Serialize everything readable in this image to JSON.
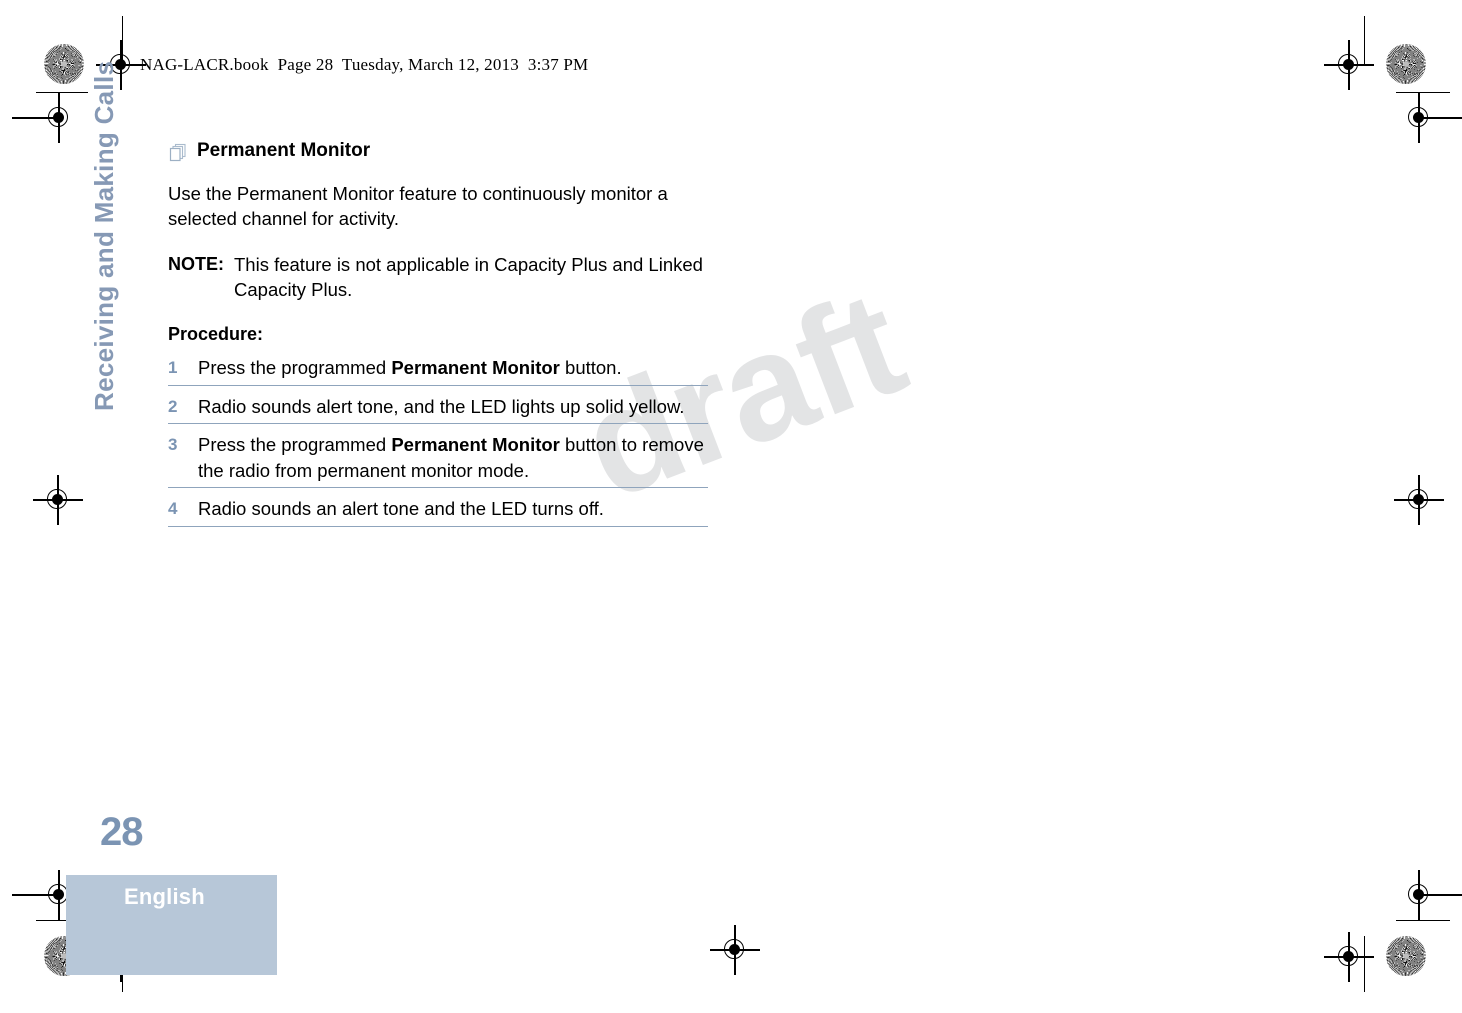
{
  "print_header": {
    "text": "NAG-LACR.book  Page 28  Tuesday, March 12, 2013  3:37 PM"
  },
  "sidebar": {
    "chapter_title": "Receiving and Making Calls"
  },
  "section": {
    "icon": "stacked-pages-icon",
    "heading": "Permanent Monitor",
    "intro": "Use the Permanent Monitor feature to continuously monitor a selected channel for activity.",
    "note_label": "NOTE:",
    "note_text": "This feature is not applicable in Capacity Plus and Linked Capacity Plus.",
    "procedure_label": "Procedure:"
  },
  "steps": [
    {
      "number": "1",
      "parts": [
        {
          "text": "Press the programmed ",
          "bold": false
        },
        {
          "text": "Permanent Monitor",
          "bold": true
        },
        {
          "text": " button.",
          "bold": false
        }
      ]
    },
    {
      "number": "2",
      "parts": [
        {
          "text": "Radio sounds alert tone, and the LED lights up solid yellow.",
          "bold": false
        }
      ]
    },
    {
      "number": "3",
      "parts": [
        {
          "text": "Press the programmed ",
          "bold": false
        },
        {
          "text": "Permanent Monitor",
          "bold": true
        },
        {
          "text": " button to remove the radio from permanent monitor mode.",
          "bold": false
        }
      ]
    },
    {
      "number": "4",
      "parts": [
        {
          "text": "Radio sounds an alert tone and the LED turns off.",
          "bold": false
        }
      ]
    }
  ],
  "watermark": {
    "text": "draft"
  },
  "footer": {
    "page_number": "28",
    "language": "English"
  },
  "colors": {
    "accent_blue": "#7b94b3",
    "rule_blue": "#8fa4bc",
    "band_blue": "#b7c7d8",
    "sidebar_blue": "#8699b5",
    "watermark_gray": "#e3e4e5"
  },
  "print_marks": {
    "registration_icon": "registration-target-icon",
    "rosette_icon": "color-rosette-icon"
  }
}
